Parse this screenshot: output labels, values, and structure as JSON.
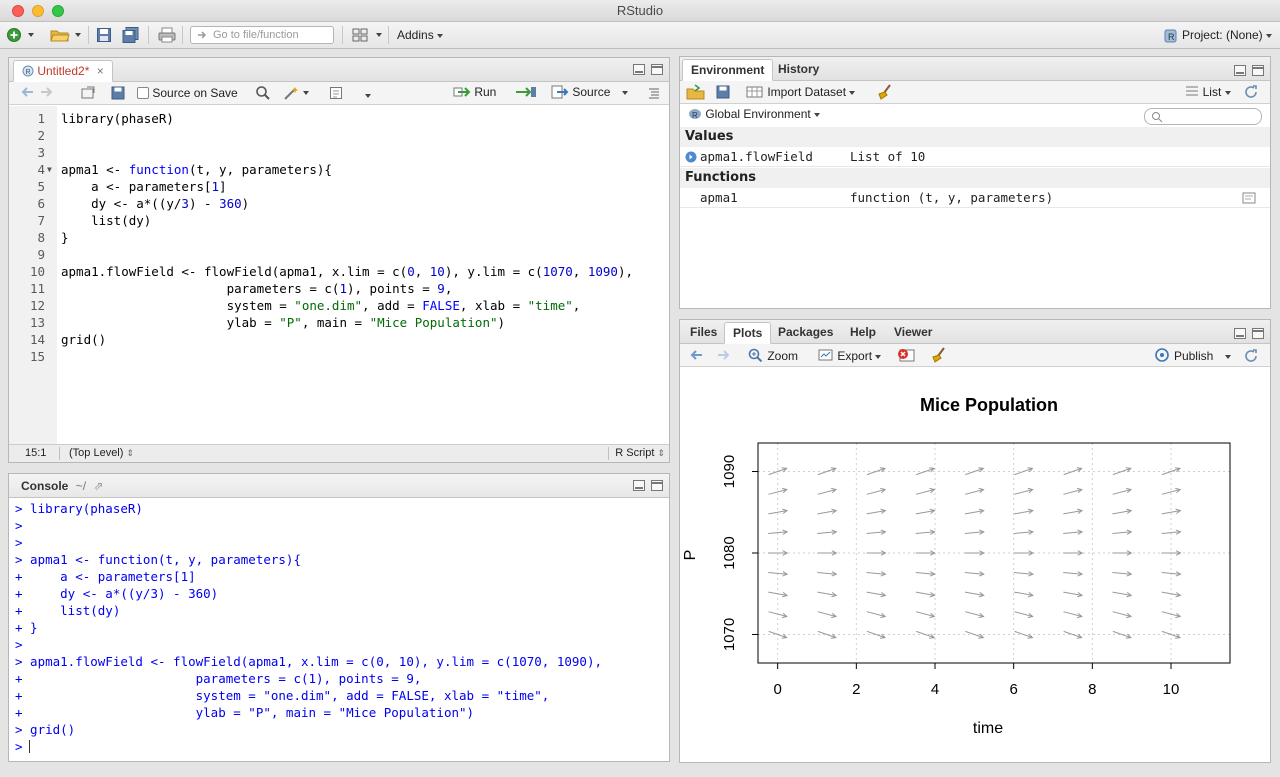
{
  "window": {
    "title": "RStudio"
  },
  "toolbar": {
    "goto_placeholder": "Go to file/function",
    "addins_label": "Addins",
    "project_label": "Project: (None)"
  },
  "editor": {
    "tab_label": "Untitled2*",
    "source_on_save_label": "Source on Save",
    "run_label": "Run",
    "source_label": "Source",
    "status_position": "15:1",
    "status_scope": "(Top Level)",
    "status_filetype": "R Script",
    "lines": [
      "library(phaseR)",
      "",
      "",
      "apma1 <- function(t, y, parameters){",
      "    a <- parameters[1]",
      "    dy <- a*((y/3) - 360)",
      "    list(dy)",
      "}",
      "",
      "apma1.flowField <- flowField(apma1, x.lim = c(0, 10), y.lim = c(1070, 1090),",
      "                      parameters = c(1), points = 9,",
      "                      system = \"one.dim\", add = FALSE, xlab = \"time\",",
      "                      ylab = \"P\", main = \"Mice Population\")",
      "grid()",
      ""
    ]
  },
  "console": {
    "tab_label": "Console",
    "path_label": "~/",
    "lines": [
      "> library(phaseR)",
      ">",
      ">",
      "> apma1 <- function(t, y, parameters){",
      "+     a <- parameters[1]",
      "+     dy <- a*((y/3) - 360)",
      "+     list(dy)",
      "+ }",
      ">",
      "> apma1.flowField <- flowField(apma1, x.lim = c(0, 10), y.lim = c(1070, 1090),",
      "+                       parameters = c(1), points = 9,",
      "+                       system = \"one.dim\", add = FALSE, xlab = \"time\",",
      "+                       ylab = \"P\", main = \"Mice Population\")",
      "> grid()",
      ">"
    ]
  },
  "environment": {
    "tabs": [
      "Environment",
      "History"
    ],
    "import_label": "Import Dataset",
    "view_mode": "List",
    "scope_label": "Global Environment",
    "values_header": "Values",
    "values": [
      {
        "name": "apma1.flowField",
        "value": "List of 10"
      }
    ],
    "functions_header": "Functions",
    "functions": [
      {
        "name": "apma1",
        "value": "function (t, y, parameters)"
      }
    ]
  },
  "files_pane": {
    "tabs": [
      "Files",
      "Plots",
      "Packages",
      "Help",
      "Viewer"
    ],
    "zoom_label": "Zoom",
    "export_label": "Export",
    "publish_label": "Publish"
  },
  "chart_data": {
    "type": "scatter",
    "title": "Mice Population",
    "xlabel": "time",
    "ylabel": "P",
    "xlim": [
      -0.5,
      11.5
    ],
    "ylim": [
      1066.5,
      1093.5
    ],
    "xticks": [
      0,
      2,
      4,
      6,
      8,
      10
    ],
    "yticks": [
      1070,
      1080,
      1090
    ],
    "grid": true,
    "field_x": [
      0,
      1.25,
      2.5,
      3.75,
      5,
      6.25,
      7.5,
      8.75,
      10
    ],
    "field_y": [
      1070,
      1072.5,
      1075,
      1077.5,
      1080,
      1082.5,
      1085,
      1087.5,
      1090
    ],
    "field_slope": "dy = (y/3) - 360",
    "arrow_color": "#999999"
  }
}
